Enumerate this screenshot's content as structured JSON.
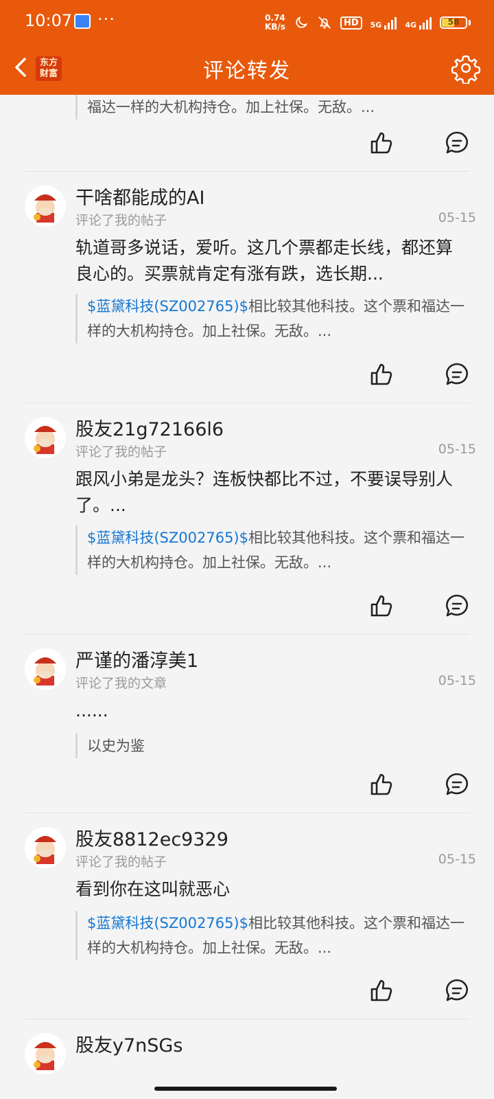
{
  "status_bar": {
    "time": "10:07",
    "more": "···",
    "net_speed_value": "0.74",
    "net_speed_unit": "KB/s",
    "hd": "HD",
    "sim1": "5G",
    "sim2": "4G",
    "battery": "58"
  },
  "header": {
    "logo_top": "东方",
    "logo_bottom": "财富",
    "title": "评论转发",
    "icons": [
      "chevron-left-icon",
      "gear-icon"
    ],
    "accent_color": "#e8590c"
  },
  "items": [
    {
      "username": "",
      "action": "",
      "date": "",
      "content": "",
      "quote_stock": "",
      "quote_text": "福达一样的大机构持仓。加上社保。无敌。..."
    },
    {
      "username": "干啥都能成的AI",
      "action": "评论了我的帖子",
      "date": "05-15",
      "content": "轨道哥多说话，爱听。这几个票都走长线，都还算良心的。买票就肯定有涨有跌，选长期...",
      "quote_stock": "$蓝黛科技(SZ002765)$",
      "quote_text": "相比较其他科技。这个票和福达一样的大机构持仓。加上社保。无敌。..."
    },
    {
      "username": "股友21g72166l6",
      "action": "评论了我的帖子",
      "date": "05-15",
      "content": "跟风小弟是龙头？连板快都比不过，不要误导别人了。...",
      "quote_stock": "$蓝黛科技(SZ002765)$",
      "quote_text": "相比较其他科技。这个票和福达一样的大机构持仓。加上社保。无敌。..."
    },
    {
      "username": "严谨的潘淳美1",
      "action": "评论了我的文章",
      "date": "05-15",
      "content": "......",
      "quote_stock": "",
      "quote_text": "以史为鉴"
    },
    {
      "username": "股友8812ec9329",
      "action": "评论了我的帖子",
      "date": "05-15",
      "content": "看到你在这叫就恶心",
      "quote_stock": "$蓝黛科技(SZ002765)$",
      "quote_text": "相比较其他科技。这个票和福达一样的大机构持仓。加上社保。无敌。..."
    },
    {
      "username": "股友y7nSGs",
      "action": "",
      "date": "",
      "content": "",
      "quote_stock": "",
      "quote_text": ""
    }
  ]
}
